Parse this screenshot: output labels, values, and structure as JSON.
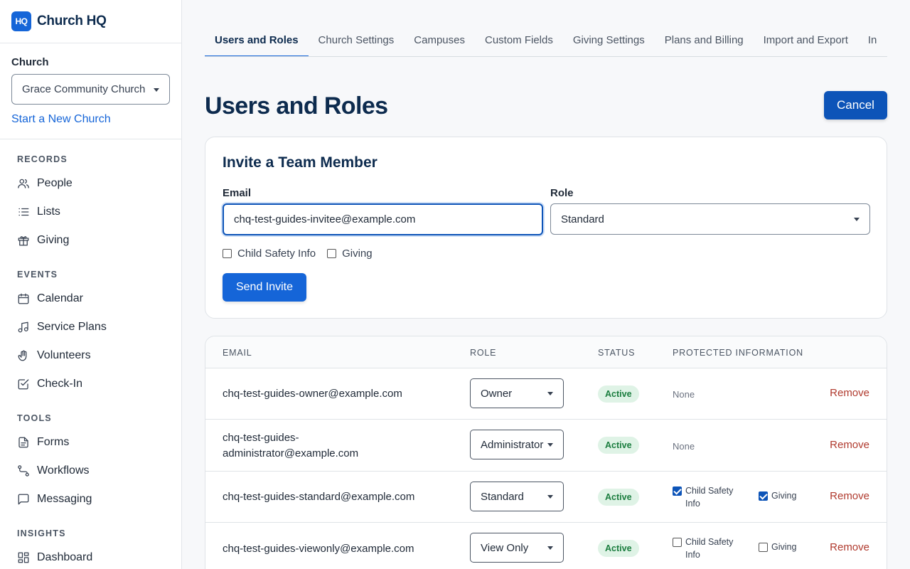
{
  "brand": {
    "logo": "HQ",
    "name": "Church HQ"
  },
  "church": {
    "label": "Church",
    "selected": "Grace Community Church",
    "new_link": "Start a New Church"
  },
  "nav": {
    "records": {
      "title": "RECORDS",
      "items": [
        "People",
        "Lists",
        "Giving"
      ]
    },
    "events": {
      "title": "EVENTS",
      "items": [
        "Calendar",
        "Service Plans",
        "Volunteers",
        "Check-In"
      ]
    },
    "tools": {
      "title": "TOOLS",
      "items": [
        "Forms",
        "Workflows",
        "Messaging"
      ]
    },
    "insights": {
      "title": "INSIGHTS",
      "items": [
        "Dashboard"
      ]
    }
  },
  "tabs": [
    "Users and Roles",
    "Church Settings",
    "Campuses",
    "Custom Fields",
    "Giving Settings",
    "Plans and Billing",
    "Import and Export",
    "In"
  ],
  "page": {
    "title": "Users and Roles",
    "cancel": "Cancel"
  },
  "invite": {
    "heading": "Invite a Team Member",
    "email_label": "Email",
    "email_value": "chq-test-guides-invitee@example.com",
    "role_label": "Role",
    "role_value": "Standard",
    "check_child": "Child Safety Info",
    "check_giving": "Giving",
    "send": "Send Invite"
  },
  "table": {
    "headers": [
      "EMAIL",
      "ROLE",
      "STATUS",
      "PROTECTED INFORMATION"
    ],
    "rows": [
      {
        "email": "chq-test-guides-owner@example.com",
        "role": "Owner",
        "status": "Active",
        "protected": "None",
        "remove": "Remove"
      },
      {
        "email": "chq-test-guides-administrator@example.com",
        "email_line1": "chq-test-guides-",
        "email_line2": "administrator@example.com",
        "role": "Administrator",
        "status": "Active",
        "protected": "None",
        "remove": "Remove"
      },
      {
        "email": "chq-test-guides-standard@example.com",
        "role": "Standard",
        "status": "Active",
        "child": "Child Safety Info",
        "child_checked": true,
        "giving": "Giving",
        "giving_checked": true,
        "remove": "Remove"
      },
      {
        "email": "chq-test-guides-viewonly@example.com",
        "role": "View Only",
        "status": "Active",
        "child": "Child Safety Info",
        "child_checked": false,
        "giving": "Giving",
        "giving_checked": false,
        "remove": "Remove"
      }
    ]
  }
}
